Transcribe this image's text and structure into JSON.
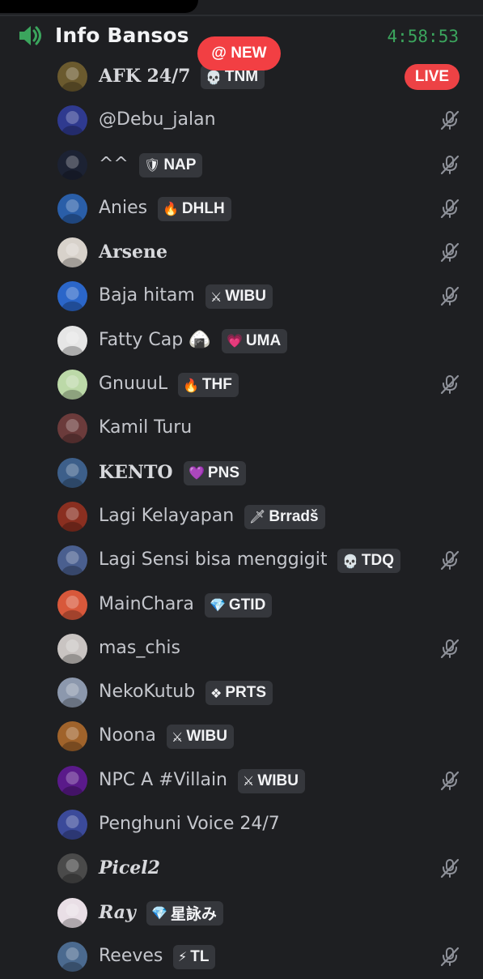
{
  "channel": {
    "name": "Info Bansos",
    "timer": "4:58:53",
    "new_label": "@ NEW",
    "live_label": "LIVE"
  },
  "colors": {
    "background": "#1e1f22",
    "accent_green": "#3ba55d",
    "badge_red": "#ed4245",
    "tag_bg": "#35373c"
  },
  "users": [
    {
      "name": "AFK 24/7",
      "tag": "TNM",
      "tag_icon": "💀",
      "tag_icon_name": "skull-icon",
      "muted": false,
      "style": "gothic",
      "avatar": "#6b5a2e"
    },
    {
      "name": "@Debu_jalan",
      "tag": "",
      "tag_icon": "",
      "tag_icon_name": "",
      "muted": true,
      "style": "normal",
      "avatar": "#2f3a8f"
    },
    {
      "name": "^^",
      "tag": "NAP",
      "tag_icon": "🛡",
      "tag_icon_name": "shield-icon",
      "muted": true,
      "style": "normal",
      "avatar": "#1c2233"
    },
    {
      "name": "Anies",
      "tag": "DHLH",
      "tag_icon": "🔥",
      "tag_icon_name": "fire-icon",
      "muted": true,
      "style": "normal",
      "avatar": "#2a5ea8"
    },
    {
      "name": "Arsene",
      "tag": "",
      "tag_icon": "",
      "tag_icon_name": "",
      "muted": true,
      "style": "gothic",
      "avatar": "#d8d2cb"
    },
    {
      "name": "Baja hitam",
      "tag": "WIBU",
      "tag_icon": "⚔",
      "tag_icon_name": "sword-icon",
      "muted": true,
      "style": "normal",
      "avatar": "#2b66c9"
    },
    {
      "name": "Fatty Cap 🍙",
      "tag": "UMA",
      "tag_icon": "💗",
      "tag_icon_name": "heart-icon",
      "muted": false,
      "style": "normal",
      "avatar": "#e6e6e6"
    },
    {
      "name": "GnuuuL",
      "tag": "THF",
      "tag_icon": "🔥",
      "tag_icon_name": "fire-icon",
      "muted": true,
      "style": "normal",
      "avatar": "#bcd9a8"
    },
    {
      "name": "Kamil Turu",
      "tag": "",
      "tag_icon": "",
      "tag_icon_name": "",
      "muted": false,
      "style": "normal",
      "avatar": "#6b3b3b"
    },
    {
      "name": "KENTO",
      "tag": "PNS",
      "tag_icon": "💜",
      "tag_icon_name": "heart-icon",
      "muted": false,
      "style": "gothic",
      "avatar": "#3d5f8a"
    },
    {
      "name": "Lagi Kelayapan",
      "tag": "Brradš",
      "tag_icon": "🗡",
      "tag_icon_name": "sword-icon",
      "muted": false,
      "style": "normal",
      "avatar": "#8a2f20"
    },
    {
      "name": "Lagi Sensi bisa menggigit",
      "tag": "TDQ",
      "tag_icon": "💀",
      "tag_icon_name": "skull-icon",
      "muted": true,
      "style": "normal",
      "avatar": "#4a5f8f"
    },
    {
      "name": "MainChara",
      "tag": "GTID",
      "tag_icon": "💎",
      "tag_icon_name": "gem-icon",
      "muted": false,
      "style": "normal",
      "avatar": "#d8583b"
    },
    {
      "name": "mas_chis",
      "tag": "",
      "tag_icon": "",
      "tag_icon_name": "",
      "muted": true,
      "style": "normal",
      "avatar": "#c9c4c2"
    },
    {
      "name": "NekoKutub",
      "tag": "PRTS",
      "tag_icon": "❖",
      "tag_icon_name": "diamond-icon",
      "muted": false,
      "style": "normal",
      "avatar": "#8c98ad"
    },
    {
      "name": "Noona",
      "tag": "WIBU",
      "tag_icon": "⚔",
      "tag_icon_name": "sword-icon",
      "muted": false,
      "style": "normal",
      "avatar": "#a0632b"
    },
    {
      "name": "NPC A #Villain",
      "tag": "WIBU",
      "tag_icon": "⚔",
      "tag_icon_name": "sword-icon",
      "muted": true,
      "style": "normal",
      "avatar": "#5a1a8a"
    },
    {
      "name": "Penghuni Voice 24/7",
      "tag": "",
      "tag_icon": "",
      "tag_icon_name": "",
      "muted": false,
      "style": "normal",
      "avatar": "#3b4a9a"
    },
    {
      "name": "Picel2",
      "tag": "",
      "tag_icon": "",
      "tag_icon_name": "",
      "muted": true,
      "style": "italic",
      "avatar": "#4a4a4a"
    },
    {
      "name": "Ray",
      "tag": "星詠み",
      "tag_icon": "💎",
      "tag_icon_name": "gem-icon",
      "muted": false,
      "style": "italic",
      "avatar": "#e9dfe6"
    },
    {
      "name": "Reeves",
      "tag": "TL",
      "tag_icon": "⚡",
      "tag_icon_name": "lightning-icon",
      "muted": true,
      "style": "normal",
      "avatar": "#4b6a8f"
    }
  ]
}
